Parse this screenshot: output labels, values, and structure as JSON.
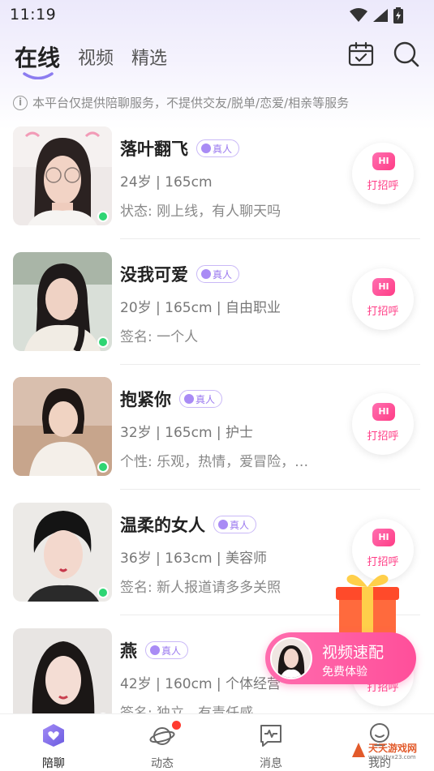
{
  "status_bar": {
    "time": "11:19"
  },
  "header": {
    "tabs": [
      {
        "label": "在线"
      },
      {
        "label": "视频"
      },
      {
        "label": "精选"
      }
    ],
    "icons": [
      "calendar-check-icon",
      "search-icon"
    ]
  },
  "notice": {
    "icon": "info-icon",
    "text": "本平台仅提供陪聊服务，不提供交友/脱单/恋爱/相亲等服务"
  },
  "verify_label": "真人",
  "greet_label": "打招呼",
  "greet_hi": "HI",
  "users": [
    {
      "name": "落叶翻飞",
      "info": "24岁 | 165cm",
      "status": "状态: 刚上线，有人聊天吗"
    },
    {
      "name": "没我可爱",
      "info": "20岁 | 165cm | 自由职业",
      "status": "签名: 一个人"
    },
    {
      "name": "抱紧你",
      "info": "32岁 | 165cm | 护士",
      "status": "个性: 乐观，热情，爱冒险，…"
    },
    {
      "name": "温柔的女人",
      "info": "36岁 | 163cm | 美容师",
      "status": "签名: 新人报道请多多关照"
    },
    {
      "name": "燕",
      "info": "42岁 | 160cm | 个体经营",
      "status": "签名: 独立，有责任感"
    }
  ],
  "video_match": {
    "title": "视频速配",
    "subtitle": "免费体验"
  },
  "bottom_nav": [
    {
      "label": "陪聊",
      "icon": "heart-chat-icon"
    },
    {
      "label": "动态",
      "icon": "planet-icon"
    },
    {
      "label": "消息",
      "icon": "message-icon"
    },
    {
      "label": "我的",
      "icon": "profile-icon"
    }
  ],
  "watermark": {
    "text": "天天游戏网",
    "url": "www.ttyx23.com"
  },
  "colors": {
    "accent": "#ff3d86",
    "verify": "#9a78ef",
    "online": "#2ed573",
    "tab_underline": "#8c7cf0"
  }
}
